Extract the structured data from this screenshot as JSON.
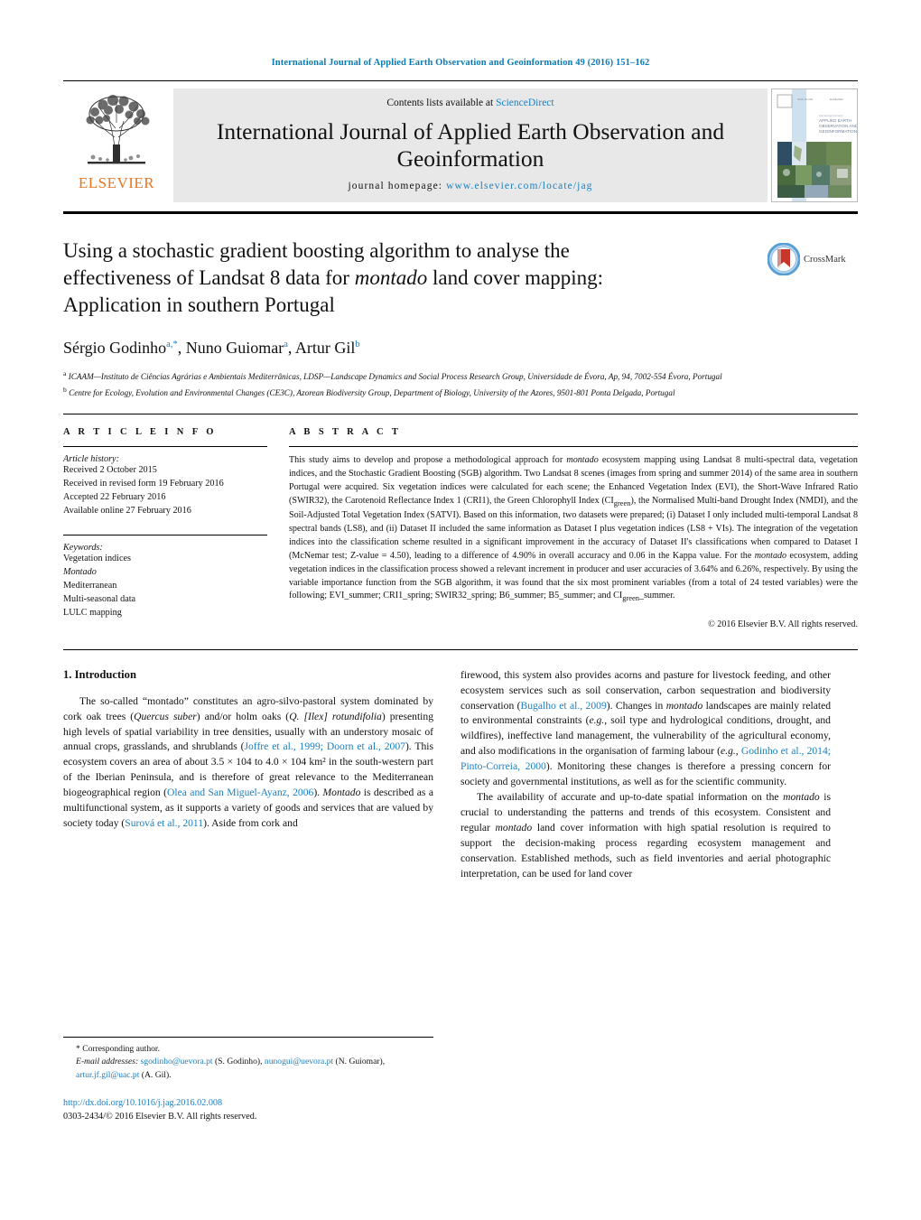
{
  "running_head": "International Journal of Applied Earth Observation and Geoinformation 49 (2016) 151–162",
  "masthead": {
    "publisher": "ELSEVIER",
    "contents_prefix": "Contents lists available at ",
    "contents_link": "ScienceDirect",
    "journal_title": "International Journal of Applied Earth Observation and Geoinformation",
    "homepage_label": "journal homepage: ",
    "homepage_url": "www.elsevier.com/locate/jag",
    "cover_caption": "APPLIED EARTH OBSERVATION AND GEOINFORMATION"
  },
  "article": {
    "title_line1": "Using a stochastic gradient boosting algorithm to analyse the",
    "title_line2_a": "effectiveness of Landsat 8 data for ",
    "title_line2_em": "montado",
    "title_line2_b": " land cover mapping:",
    "title_line3": "Application in southern Portugal",
    "crossmark_label": "CrossMark",
    "authors_plain": "Sérgio Godinho",
    "author1": "Sérgio Godinho",
    "author1_sup": "a,*",
    "author2": ", Nuno Guiomar",
    "author2_sup": "a",
    "author3": ", Artur Gil",
    "author3_sup": "b",
    "affiliation_a": "ICAAM—Instituto de Ciências Agrárias e Ambientais Mediterrânicas, LDSP—Landscape Dynamics and Social Process Research Group, Universidade de Évora, Ap, 94, 7002-554 Évora, Portugal",
    "affiliation_b": "Centre for Ecology, Evolution and Environmental Changes (CE3C), Azorean Biodiversity Group, Department of Biology, University of the Azores, 9501-801 Ponta Delgada, Portugal"
  },
  "info": {
    "heading": "A R T I C L E   I N F O",
    "history_label": "Article history:",
    "history": [
      "Received 2 October 2015",
      "Received in revised form 19 February 2016",
      "Accepted 22 February 2016",
      "Available online 27 February 2016"
    ],
    "keywords_label": "Keywords:",
    "keywords": [
      "Vegetation indices",
      "Montado",
      "Mediterranean",
      "Multi-seasonal data",
      "LULC mapping"
    ]
  },
  "abstract": {
    "heading": "A B S T R A C T",
    "text_1": "This study aims to develop and propose a methodological approach for ",
    "em_1": "montado",
    "text_2": " ecosystem mapping using Landsat 8 multi-spectral data, vegetation indices, and the Stochastic Gradient Boosting (SGB) algorithm. Two Landsat 8 scenes (images from spring and summer 2014) of the same area in southern Portugal were acquired. Six vegetation indices were calculated for each scene; the Enhanced Vegetation Index (EVI), the Short-Wave Infrared Ratio (SWIR32), the Carotenoid Reflectance Index 1 (CRI1), the Green Chlorophyll Index (CI",
    "sub_green": "green",
    "text_3": "), the Normalised Multi-band Drought Index (NMDI), and the Soil-Adjusted Total Vegetation Index (SATVI). Based on this information, two datasets were prepared; (i) Dataset I only included multi-temporal Landsat 8 spectral bands (LS8), and (ii) Dataset II included the same information as Dataset I plus vegetation indices (LS8 + VIs). The integration of the vegetation indices into the classification scheme resulted in a significant improvement in the accuracy of Dataset II's classifications when compared to Dataset I (McNemar test; Z-value = 4.50), leading to a difference of 4.90% in overall accuracy and 0.06 in the Kappa value. For the ",
    "em_2": "montado",
    "text_4": " ecosystem, adding vegetation indices in the classification process showed a relevant increment in producer and user accuracies of 3.64% and 6.26%, respectively. By using the variable importance function from the SGB algorithm, it was found that the six most prominent variables (from a total of 24 tested variables) were the following; EVI_summer; CRI1_spring; SWIR32_spring; B6_summer; B5_summer; and CI",
    "sub_green2": "green",
    "text_5": "_summer.",
    "copyright": "© 2016 Elsevier B.V. All rights reserved."
  },
  "body": {
    "section_number_title": "1.  Introduction",
    "left_p1_a": "The so-called “montado” constitutes an agro-silvo-pastoral system dominated by cork oak trees (",
    "left_p1_em1": "Quercus suber",
    "left_p1_b": ") and/or holm oaks (",
    "left_p1_em2": "Q. [Ilex] rotundifolia",
    "left_p1_c": ") presenting high levels of spatial variability in tree densities, usually with an understory mosaic of annual crops, grasslands, and shrublands (",
    "left_p1_ref1": "Joffre et al., 1999; Doorn et al., 2007",
    "left_p1_d": "). This ecosystem covers an area of about 3.5 × 104 to 4.0 × 104 km² in the south-western part of the Iberian Peninsula, and is therefore of great relevance to the Mediterranean biogeographical region (",
    "left_p1_ref2": "Olea and San Miguel-Ayanz, 2006",
    "left_p1_e": "). ",
    "left_p1_em3": "Montado",
    "left_p1_f": " is described as a multifunctional system, as it supports a variety of goods and services that are valued by society today (",
    "left_p1_ref3": "Surová et al., 2011",
    "left_p1_g": "). Aside from cork and",
    "right_p1_a": "firewood, this system also provides acorns and pasture for livestock feeding, and other ecosystem services such as soil conservation, carbon sequestration and biodiversity conservation (",
    "right_p1_ref1": "Bugalho et al., 2009",
    "right_p1_b": "). Changes in ",
    "right_p1_em1": "montado",
    "right_p1_c": " landscapes are mainly related to environmental constraints (",
    "right_p1_em2": "e.g.",
    "right_p1_d": ", soil type and hydrological conditions, drought, and wildfires), ineffective land management, the vulnerability of the agricultural economy, and also modifications in the organisation of farming labour (",
    "right_p1_em3": "e.g.",
    "right_p1_e": ", ",
    "right_p1_ref2": "Godinho et al., 2014; Pinto-Correia, 2000",
    "right_p1_f": "). Monitoring these changes is therefore a pressing concern for society and governmental institutions, as well as for the scientific community.",
    "right_p2_a": "The availability of accurate and up-to-date spatial information on the ",
    "right_p2_em1": "montado",
    "right_p2_b": " is crucial to understanding the patterns and trends of this ecosystem. Consistent and regular ",
    "right_p2_em2": "montado",
    "right_p2_c": " land cover information with high spatial resolution is required to support the decision-making process regarding ecosystem management and conservation. Established methods, such as field inventories and aerial photographic interpretation, can be used for land cover"
  },
  "footnote": {
    "corresponding": "* Corresponding author.",
    "email_label": "E-mail addresses:",
    "email1": "sgodinho@uevora.pt",
    "email1_owner": " (S. Godinho), ",
    "email2": "nunogui@uevora.pt",
    "email2_owner": " (N. Guiomar), ",
    "email3": "artur.jf.gil@uac.pt",
    "email3_owner": " (A. Gil).",
    "doi": "http://dx.doi.org/10.1016/j.jag.2016.02.008",
    "issn": "0303-2434/© 2016 Elsevier B.V. All rights reserved."
  },
  "colors": {
    "link": "#1a7fc1",
    "elsevier_orange": "#E87722",
    "running_head": "#0b7bb5"
  }
}
